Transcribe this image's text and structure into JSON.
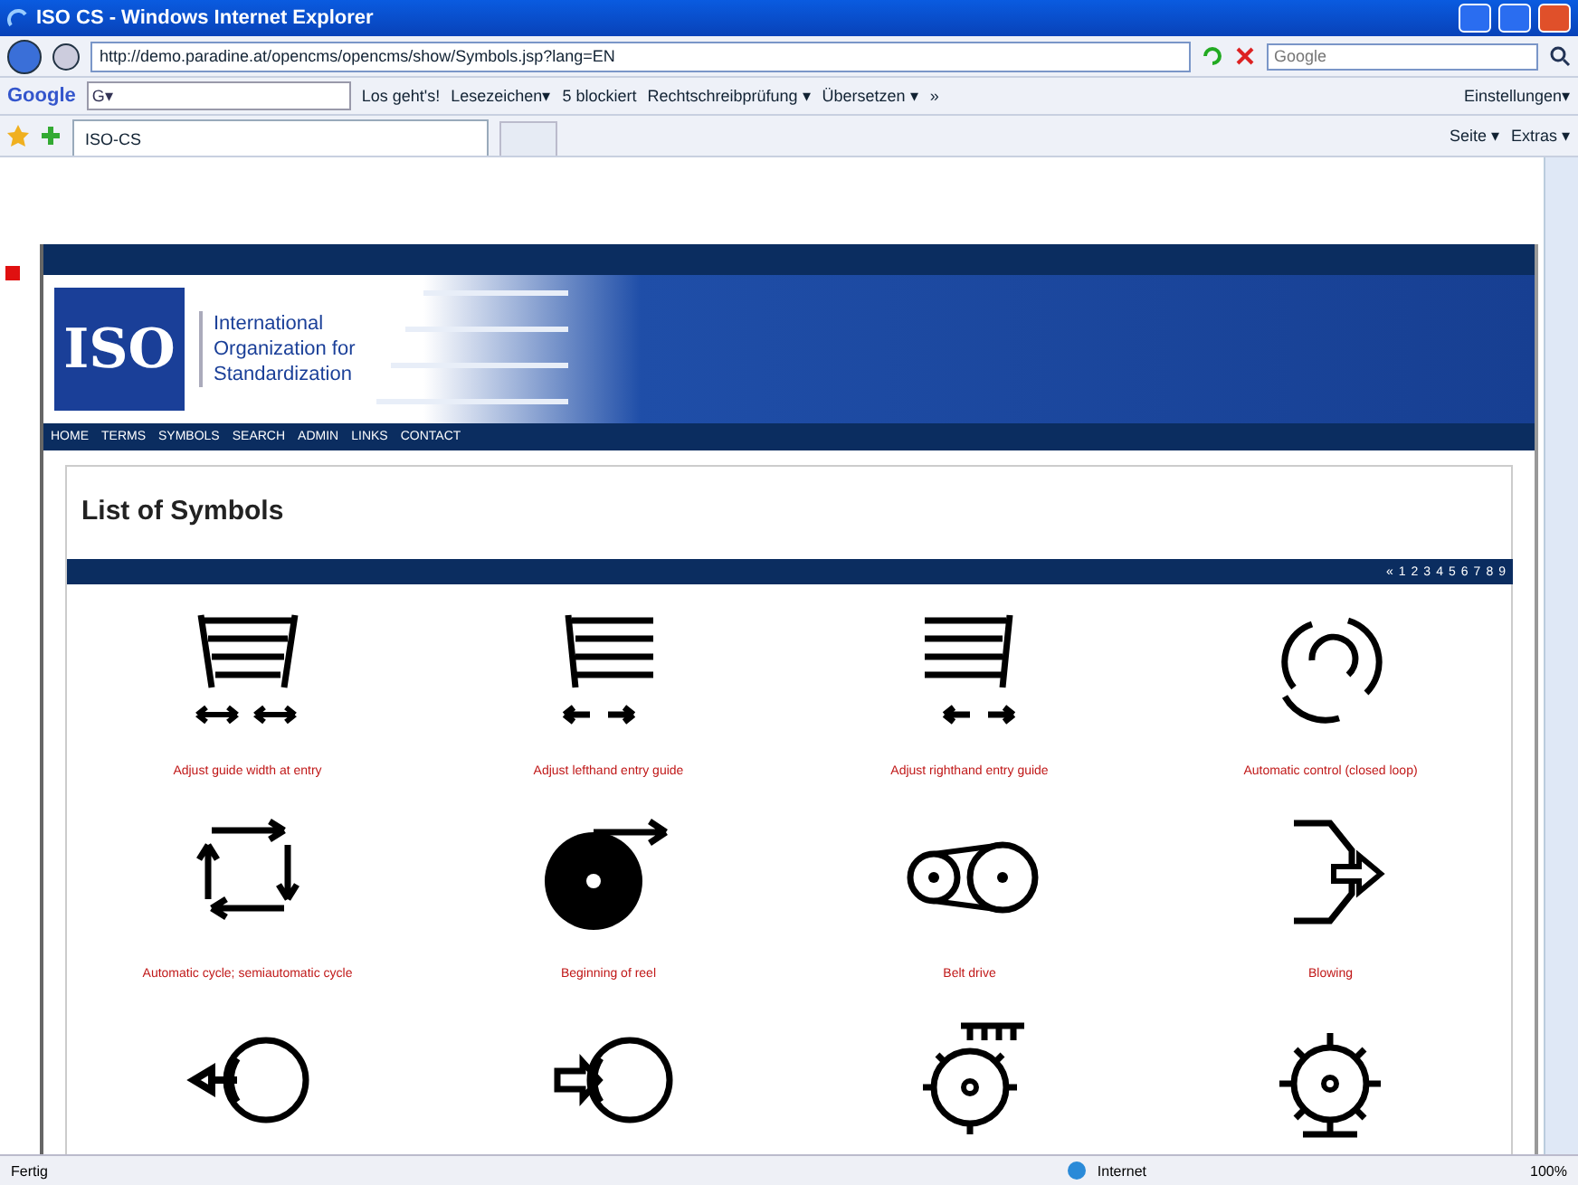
{
  "window": {
    "title": "ISO CS - Windows Internet Explorer"
  },
  "address_bar": {
    "url": "http://demo.paradine.at/opencms/opencms/show/Symbols.jsp?lang=EN",
    "search_placeholder": "Google"
  },
  "google_toolbar": {
    "logo": "Google",
    "field_prefix": "G▾",
    "go": "Los geht's!",
    "items": [
      "Lesezeichen▾",
      "5 blockiert",
      "Rechtschreibprüfung ▾",
      "Übersetzen ▾",
      "»"
    ],
    "settings": "Einstellungen▾"
  },
  "tabs": [
    {
      "label": "ISO-CS",
      "selected": true
    }
  ],
  "command_bar": [
    "Seite ▾",
    "Extras ▾"
  ],
  "site": {
    "org_lines": [
      "International",
      "Organization for",
      "Standardization"
    ],
    "logo": "ISO",
    "nav": [
      "HOME",
      "TERMS",
      "SYMBOLS",
      "SEARCH",
      "ADMIN",
      "LINKS",
      "CONTACT"
    ],
    "heading": "List of Symbols",
    "pagination": [
      "«",
      "1",
      "2",
      "3",
      "4",
      "5",
      "6",
      "7",
      "8",
      "9"
    ],
    "symbols": [
      {
        "label": "Adjust guide width at entry"
      },
      {
        "label": "Adjust lefthand entry guide"
      },
      {
        "label": "Adjust righthand entry guide"
      },
      {
        "label": "Automatic control (closed loop)"
      },
      {
        "label": "Automatic cycle; semiautomatic cycle"
      },
      {
        "label": "Beginning of reel"
      },
      {
        "label": "Belt drive"
      },
      {
        "label": "Blowing"
      }
    ]
  },
  "status_bar": {
    "text": "Fertig",
    "zone": "Internet",
    "zoom": "100%"
  }
}
